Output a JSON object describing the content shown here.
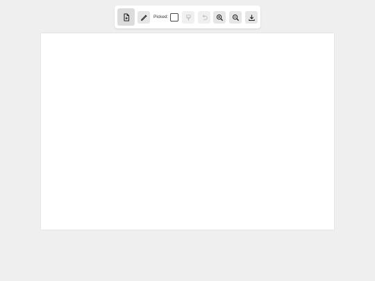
{
  "toolbar": {
    "open_file_icon": "file-icon",
    "eyedropper_icon": "eyedropper-icon",
    "picked_label": "Picked:",
    "picked_color": "#ffffff",
    "paint_bucket_icon": "paint-bucket-icon",
    "undo_icon": "undo-icon",
    "zoom_in_icon": "zoom-in-icon",
    "zoom_out_icon": "zoom-out-icon",
    "download_icon": "download-icon"
  },
  "colors": {
    "background": "#efefef",
    "toolbar": "#ffffff",
    "button": "#e6e6e6",
    "canvas": "#ffffff"
  }
}
